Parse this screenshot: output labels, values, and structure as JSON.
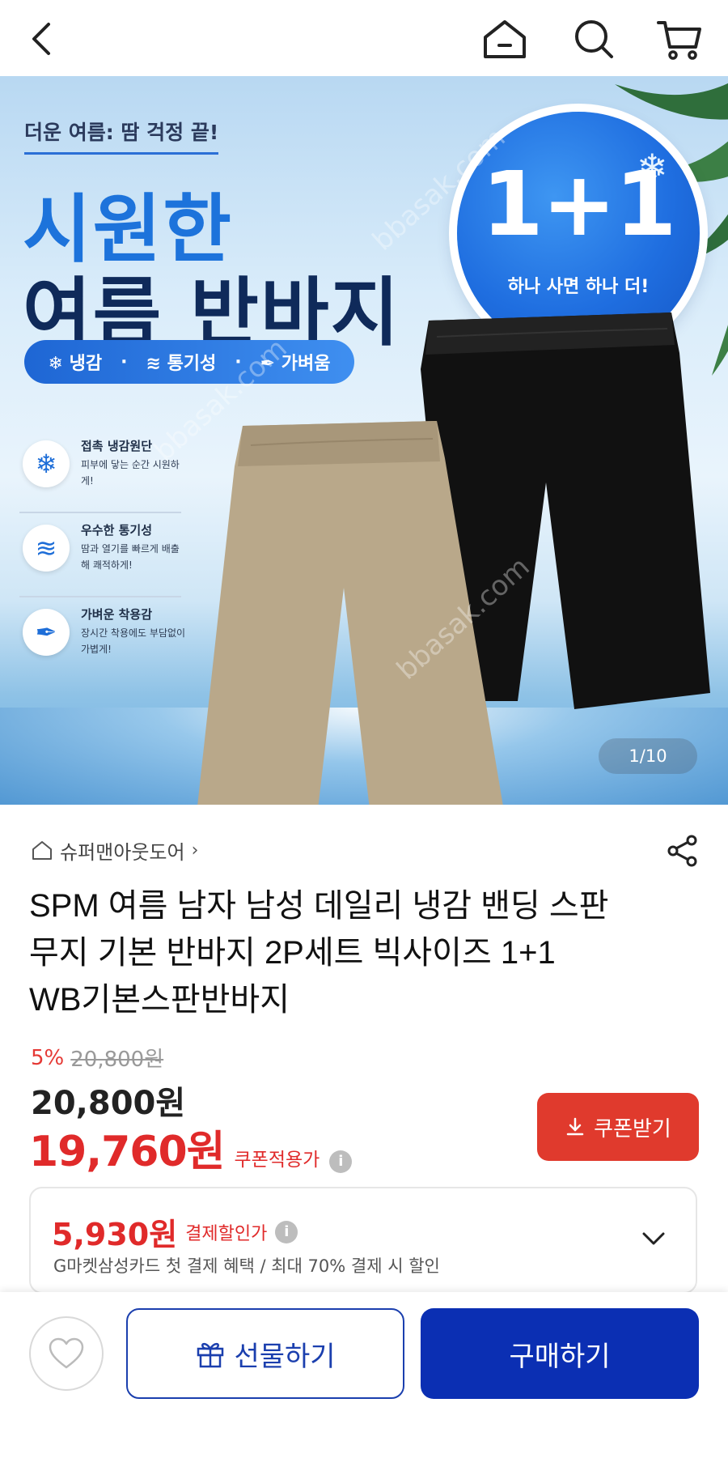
{
  "nav": {
    "back_icon": "chevron-left-icon",
    "home_icon": "home-icon",
    "search_icon": "search-icon",
    "cart_icon": "cart-icon"
  },
  "banner": {
    "tagline": "더운 여름: 땀 걱정 끝!",
    "title_line1": "시원한",
    "title_line2": "여름 반바지",
    "features_pill": [
      "냉감",
      "통기성",
      "가벼움"
    ],
    "promo": {
      "big": "1+1",
      "small": "하나 사면 하나 더!"
    },
    "feature_list": [
      {
        "icon": "snowflake-icon",
        "title": "접촉 냉감원단",
        "desc": "피부에 닿는 순간 시원하게!"
      },
      {
        "icon": "wind-icon",
        "title": "우수한 통기성",
        "desc": "땀과 열기를 빠르게 배출해 쾌적하게!"
      },
      {
        "icon": "feather-icon",
        "title": "가벼운 착용감",
        "desc": "장시간 착용에도 부담없이 가볍게!"
      }
    ],
    "watermark": "bbasak.com",
    "page_counter": "1/10",
    "colors": {
      "beige_shorts": "#b9a88a",
      "black_shorts": "#111111",
      "accent_blue": "#1d73db"
    }
  },
  "product": {
    "store_name": "슈퍼맨아웃도어",
    "title": "SPM 여름 남자 남성 데일리 냉감 밴딩 스판 무지 기본 반바지 2P세트 빅사이즈 1+1 WB기본스판반바지",
    "discount_rate": "5%",
    "original_price": "20,800원",
    "list_price": "20,800원",
    "coupon_price": "19,760원",
    "coupon_price_label": "쿠폰적용가",
    "coupon_button": "쿠폰받기"
  },
  "payment_benefit": {
    "amount": "5,930원",
    "label": "결제할인가",
    "description": "G마켓삼성카드 첫 결제 혜택 / 최대 70% 결제 시 할인"
  },
  "bottom_bar": {
    "gift_label": "선물하기",
    "buy_label": "구매하기"
  }
}
